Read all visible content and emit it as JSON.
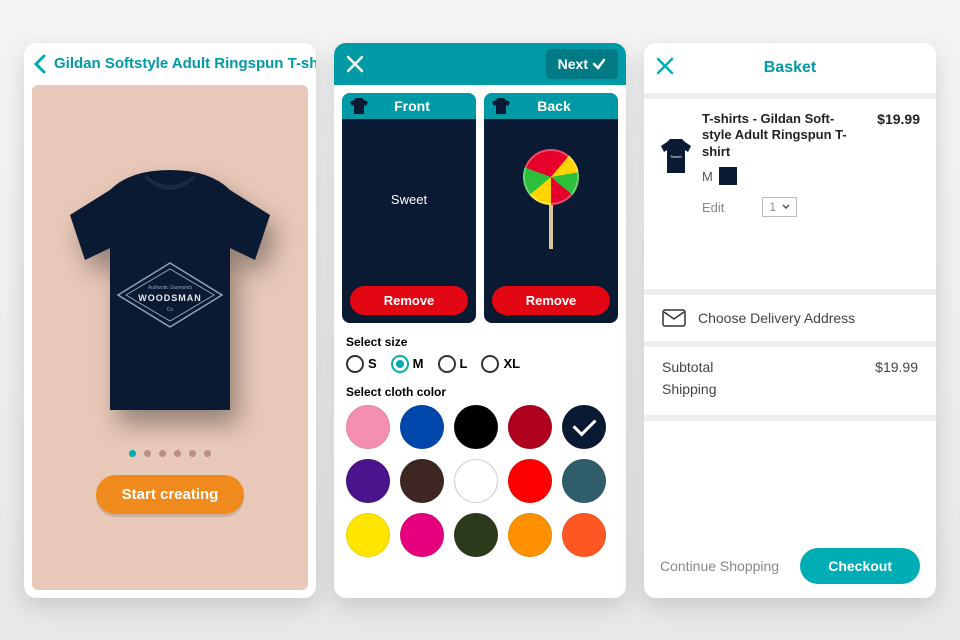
{
  "p1": {
    "title": "Gildan Softstyle Adult Ringspun T-shirt",
    "shirt_text1": "Authentic Garments",
    "shirt_text2": "WOODSMAN",
    "shirt_text3": "Co",
    "start_button": "Start creating",
    "dots_total": 6,
    "dots_active_index": 0
  },
  "p2": {
    "next_label": "Next",
    "front_label": "Front",
    "back_label": "Back",
    "front_text": "Sweet",
    "remove_label": "Remove",
    "size_label": "Select size",
    "sizes": [
      "S",
      "M",
      "L",
      "XL"
    ],
    "selected_size": "M",
    "color_label": "Select cloth color",
    "colors": [
      {
        "hex": "#f48fb1"
      },
      {
        "hex": "#0047ab"
      },
      {
        "hex": "#000000"
      },
      {
        "hex": "#b00020"
      },
      {
        "hex": "#0a1a33",
        "selected": true
      },
      {
        "hex": "#4a148c"
      },
      {
        "hex": "#3e2723"
      },
      {
        "hex": "#ffffff"
      },
      {
        "hex": "#ff0000"
      },
      {
        "hex": "#2f5d6a"
      },
      {
        "hex": "#ffe500"
      },
      {
        "hex": "#e6007e"
      },
      {
        "hex": "#2b3a1a"
      },
      {
        "hex": "#ff9100"
      },
      {
        "hex": "#ff5722"
      }
    ]
  },
  "p3": {
    "title": "Basket",
    "item_name": "T-shirts - Gildan Soft-style Adult Ringspun T-shirt",
    "item_size": "M",
    "item_thumb_text": "Sweet",
    "edit_label": "Edit",
    "qty": "1",
    "price": "$19.99",
    "delivery_label": "Choose Delivery Address",
    "subtotal_label": "Subtotal",
    "subtotal_value": "$19.99",
    "shipping_label": "Shipping",
    "continue_label": "Continue Shopping",
    "checkout_label": "Checkout"
  }
}
